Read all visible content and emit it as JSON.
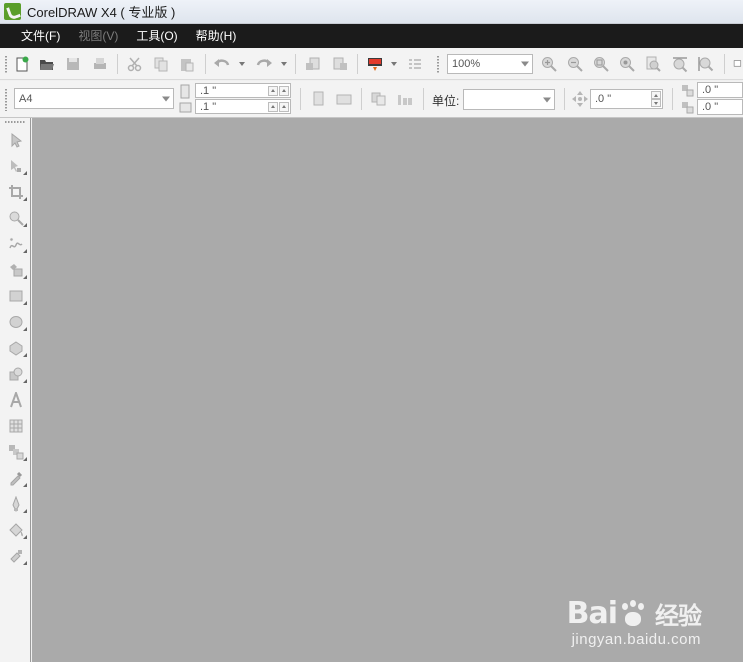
{
  "window": {
    "title": "CorelDRAW X4 ( 专业版 )"
  },
  "menu": {
    "items": [
      {
        "label": "文件(F)",
        "enabled": true
      },
      {
        "label": "视图(V)",
        "enabled": false
      },
      {
        "label": "工具(O)",
        "enabled": true
      },
      {
        "label": "帮助(H)",
        "enabled": true
      }
    ]
  },
  "standard_toolbar": {
    "icons": [
      "new-document-icon",
      "open-icon",
      "save-icon",
      "print-icon",
      "cut-icon",
      "copy-icon",
      "paste-icon",
      "undo-icon",
      "redo-icon",
      "import-icon",
      "export-icon",
      "application-launcher-icon",
      "options-icon"
    ],
    "zoom_value": "100%",
    "zoom_icons": [
      "zoom-in-icon",
      "zoom-out-icon",
      "zoom-to-selected-icon",
      "zoom-to-all-icon",
      "zoom-to-page-icon",
      "zoom-to-width-icon",
      "zoom-to-height-icon"
    ]
  },
  "property_bar": {
    "page_size": "A4",
    "width_value": ".1 \"",
    "height_value": ".1 \"",
    "units_label": "单位:",
    "units_value": "",
    "nudge_value": ".0 \"",
    "duplicate_x": ".0 \"",
    "duplicate_y": ".0 \""
  },
  "toolbox": {
    "tools": [
      "pick-tool-icon",
      "shape-tool-icon",
      "crop-tool-icon",
      "zoom-tool-icon",
      "freehand-tool-icon",
      "smart-fill-tool-icon",
      "rectangle-tool-icon",
      "ellipse-tool-icon",
      "polygon-tool-icon",
      "basic-shapes-tool-icon",
      "text-tool-icon",
      "table-tool-icon",
      "interactive-blend-tool-icon",
      "eyedropper-tool-icon",
      "outline-tool-icon",
      "fill-tool-icon",
      "interactive-fill-tool-icon"
    ]
  },
  "watermark": {
    "brand": "Bai",
    "brand_end": "经验",
    "url": "jingyan.baidu.com"
  },
  "colors": {
    "menubar_bg": "#1b1b1b",
    "workspace_bg": "#aaaaaa",
    "toolbar_bg": "#f3f3f3"
  }
}
